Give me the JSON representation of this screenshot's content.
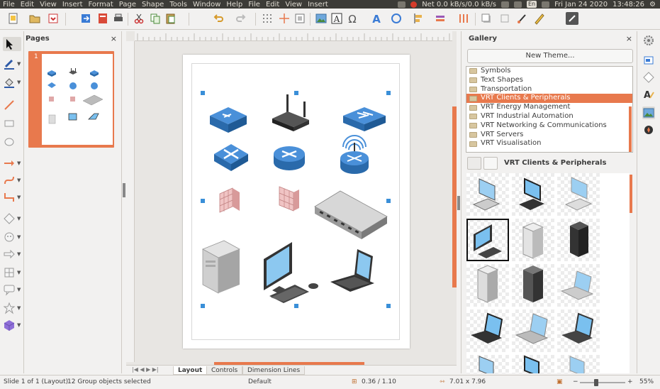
{
  "menubar": {
    "items": [
      "File",
      "Edit",
      "View",
      "Insert",
      "Format",
      "Page",
      "Shape",
      "Tools",
      "Window",
      "Help",
      "File",
      "Edit",
      "View",
      "Insert"
    ],
    "net": "Net 0.0 kB/s/0.0 kB/s",
    "lang": "En",
    "datetime": "Fri Jan 24 2020",
    "time": "13:48:26"
  },
  "pages_panel": {
    "title": "Pages",
    "close": "×",
    "slide_number": "1"
  },
  "gallery": {
    "title": "Gallery",
    "close": "×",
    "new_theme": "New Theme...",
    "themes": [
      "Symbols",
      "Text Shapes",
      "Transportation",
      "VRT Clients & Peripherals",
      "VRT Energy Management",
      "VRT Industrial Automation",
      "VRT Networking & Communications",
      "VRT Servers",
      "VRT Visualisation"
    ],
    "selected_theme_index": 3,
    "current_theme": "VRT Clients & Peripherals"
  },
  "tabs": [
    "Layout",
    "Controls",
    "Dimension Lines"
  ],
  "status": {
    "slide": "Slide 1 of 1 (Layout)",
    "selection": "12 Group objects selected",
    "style": "Default",
    "position": "0.36 / 1.10",
    "size": "7.01 x 7.96",
    "zoom": "55%"
  },
  "colors": {
    "accent": "#e8794d",
    "menubar": "#3c3b37",
    "selection_handle": "#3a8fd8"
  }
}
